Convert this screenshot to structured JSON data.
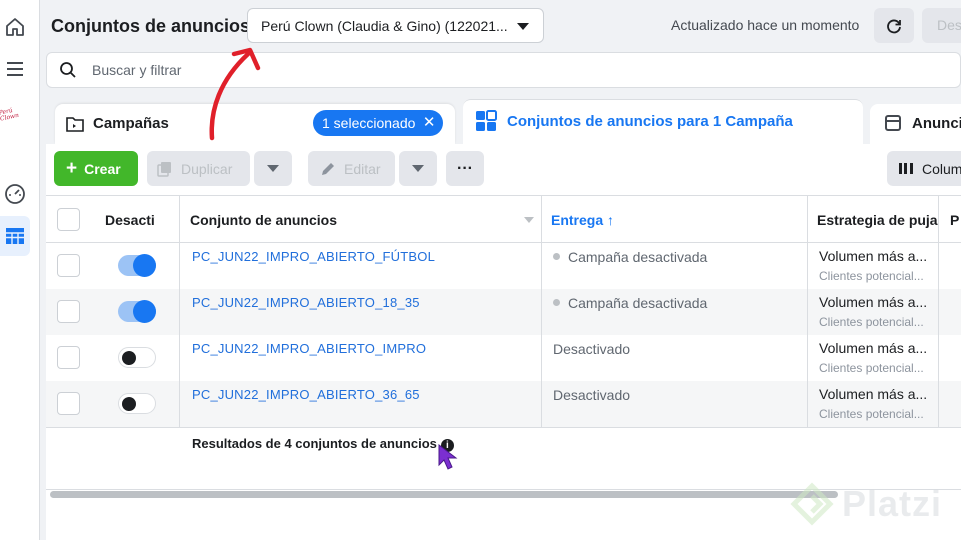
{
  "header": {
    "title": "Conjuntos de anuncios",
    "account": "Perú Clown (Claudia & Gino) (122021...",
    "updated": "Actualizado hace un momento",
    "discard_label": "Des"
  },
  "search": {
    "placeholder": "Buscar y filtrar"
  },
  "tabs": {
    "campaigns": "Campañas",
    "selected_pill": "1 seleccionado",
    "adsets": "Conjuntos de anuncios para 1 Campaña",
    "ads": "Anunci"
  },
  "toolbar": {
    "create": "Crear",
    "duplicate": "Duplicar",
    "edit": "Editar",
    "columns": "Colum"
  },
  "table": {
    "columns": [
      "Desactiv",
      "Conjunto de anuncios",
      "Entrega ↑",
      "Estrategia de puja",
      "P"
    ],
    "rows": [
      {
        "active": true,
        "name": "PC_JUN22_IMPRO_ABIERTO_FÚTBOL",
        "delivery": "Campaña desactivada",
        "dot": true,
        "strategy": "Volumen más a...",
        "strategy_sub": "Clientes potencial..."
      },
      {
        "active": true,
        "name": "PC_JUN22_IMPRO_ABIERTO_18_35",
        "delivery": "Campaña desactivada",
        "dot": true,
        "strategy": "Volumen más a...",
        "strategy_sub": "Clientes potencial..."
      },
      {
        "active": false,
        "name": "PC_JUN22_IMPRO_ABIERTO_IMPRO",
        "delivery": "Desactivado",
        "dot": false,
        "strategy": "Volumen más a...",
        "strategy_sub": "Clientes potencial..."
      },
      {
        "active": false,
        "name": "PC_JUN22_IMPRO_ABIERTO_36_65",
        "delivery": "Desactivado",
        "dot": false,
        "strategy": "Volumen más a...",
        "strategy_sub": "Clientes potencial..."
      }
    ],
    "results": "Resultados de 4 conjuntos de anuncios"
  },
  "sidebar": {
    "logo_text": "Perú Clown"
  },
  "watermark": {
    "text": "Platzi"
  },
  "colors": {
    "accent": "#1877f2",
    "create_green": "#42b72a",
    "annotation_red": "#e0202a",
    "cursor_purple": "#7b2fd0"
  }
}
